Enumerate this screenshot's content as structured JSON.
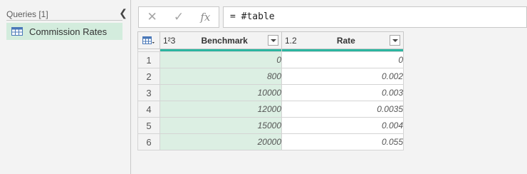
{
  "queries": {
    "header": "Queries [1]",
    "items": [
      {
        "label": "Commission Rates",
        "icon": "table-icon",
        "selected": true
      }
    ]
  },
  "formula_bar": {
    "cancel_icon": "close-icon",
    "commit_icon": "check-icon",
    "fx_label": "fx",
    "formula": "= #table"
  },
  "grid": {
    "columns": [
      {
        "type_badge": "1²3",
        "label": "Benchmark"
      },
      {
        "type_badge": "1.2",
        "label": "Rate"
      }
    ],
    "rows": [
      {
        "num": "1",
        "benchmark": "0",
        "rate": "0"
      },
      {
        "num": "2",
        "benchmark": "800",
        "rate": "0.002"
      },
      {
        "num": "3",
        "benchmark": "10000",
        "rate": "0.003"
      },
      {
        "num": "4",
        "benchmark": "12000",
        "rate": "0.0035"
      },
      {
        "num": "5",
        "benchmark": "15000",
        "rate": "0.004"
      },
      {
        "num": "6",
        "benchmark": "20000",
        "rate": "0.055"
      }
    ]
  },
  "colors": {
    "selected_query_bg": "#d3ecdd",
    "benchmark_cells_bg": "#dcefe3",
    "quality_bar": "#2bb5a0"
  }
}
